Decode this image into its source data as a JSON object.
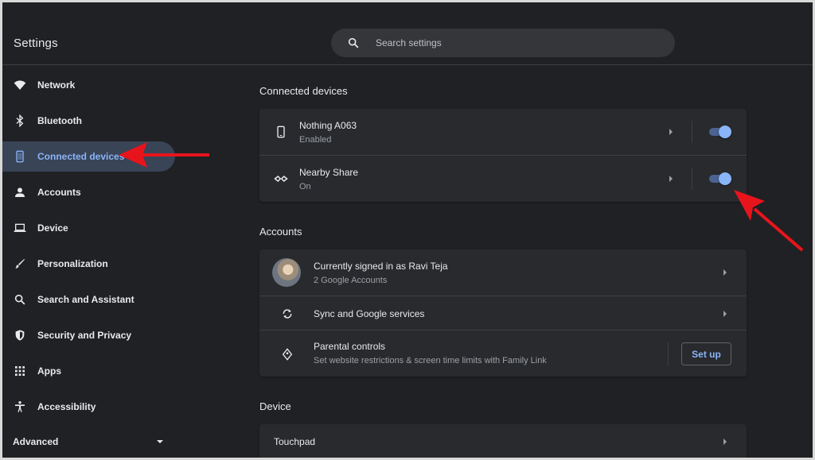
{
  "header": {
    "title": "Settings",
    "search_placeholder": "Search settings"
  },
  "sidebar": {
    "items": [
      {
        "label": "Network",
        "icon": "wifi-icon"
      },
      {
        "label": "Bluetooth",
        "icon": "bluetooth-icon"
      },
      {
        "label": "Connected devices",
        "icon": "phone-icon",
        "active": true
      },
      {
        "label": "Accounts",
        "icon": "person-icon"
      },
      {
        "label": "Device",
        "icon": "laptop-icon"
      },
      {
        "label": "Personalization",
        "icon": "brush-icon"
      },
      {
        "label": "Search and Assistant",
        "icon": "search-icon"
      },
      {
        "label": "Security and Privacy",
        "icon": "shield-icon"
      },
      {
        "label": "Apps",
        "icon": "apps-grid-icon"
      },
      {
        "label": "Accessibility",
        "icon": "accessibility-icon"
      }
    ],
    "advanced_label": "Advanced"
  },
  "sections": {
    "connected_devices": {
      "title": "Connected devices",
      "rows": [
        {
          "title": "Nothing A063",
          "subtitle": "Enabled",
          "toggle_on": true
        },
        {
          "title": "Nearby Share",
          "subtitle": "On",
          "toggle_on": true
        }
      ]
    },
    "accounts": {
      "title": "Accounts",
      "signed_in_title": "Currently signed in as Ravi Teja",
      "signed_in_sub": "2 Google Accounts",
      "sync_title": "Sync and Google services",
      "parental_title": "Parental controls",
      "parental_sub": "Set website restrictions & screen time limits with Family Link",
      "setup_label": "Set up"
    },
    "device": {
      "title": "Device",
      "touchpad_label": "Touchpad"
    }
  },
  "colors": {
    "background": "#202124",
    "card": "#292a2d",
    "accent": "#8ab4f8",
    "active_nav": "#394457",
    "annotation_arrow": "#e8141c"
  }
}
